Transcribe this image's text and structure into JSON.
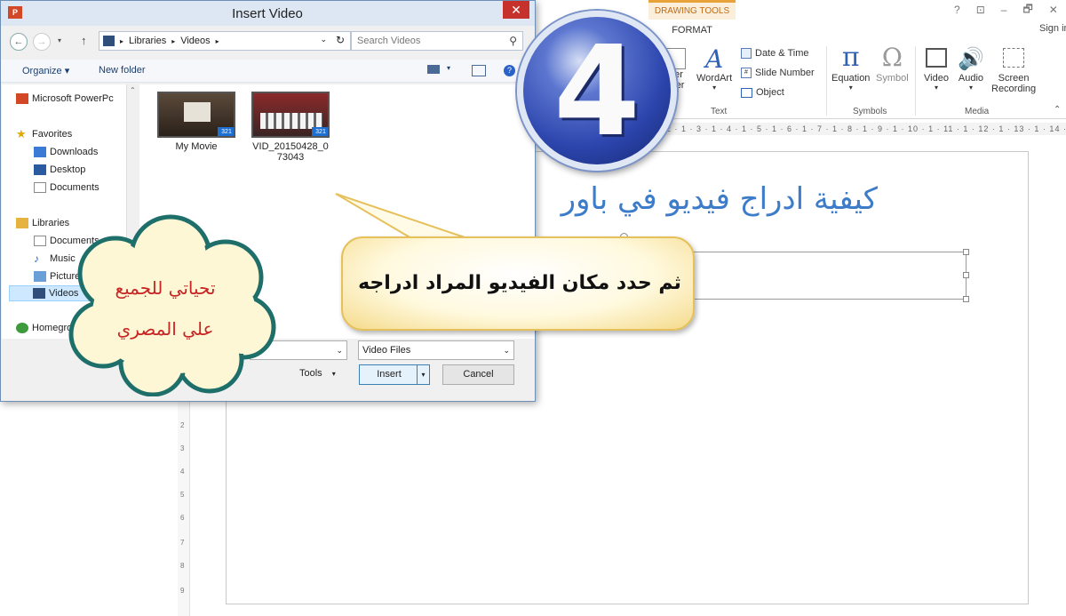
{
  "ppt": {
    "help": "?",
    "minimize": "–",
    "restore": "🗗",
    "close": "✕",
    "sign_in": "Sign in",
    "drawing_tools": "DRAWING TOOLS",
    "format_tab": "FORMAT",
    "ribbon": {
      "header_footer_top": "der",
      "header_footer_bottom": "oter",
      "wordart": "WordArt",
      "date_time": "Date & Time",
      "slide_number": "Slide Number",
      "object": "Object",
      "text_group": "Text",
      "equation": "Equation",
      "symbol": "Symbol",
      "symbols_group": "Symbols",
      "video": "Video",
      "audio": "Audio",
      "screen_recording_1": "Screen",
      "screen_recording_2": "Recording",
      "media_group": "Media"
    },
    "ruler": "2 · 1 · 3 · 1 · 4 · 1 · 5 · 1 · 6 · 1 · 7 · 1 · 8 · 1 · 9 · 1 · 10 · 1 · 11 · 1 · 12 · 1 · 13 · 1 · 14 · 1 · 15 · 1 · 16 ·",
    "vruler": [
      "2",
      "3",
      "4",
      "5",
      "6",
      "7",
      "8",
      "9"
    ],
    "slide_title": "كيفية ادراج فيديو في باور"
  },
  "dialog": {
    "title": "Insert Video",
    "app_icon": "P",
    "address": [
      "Libraries",
      "Videos"
    ],
    "search_placeholder": "Search Videos",
    "organize": "Organize ▾",
    "new_folder": "New folder",
    "nav": {
      "powerpoint": "Microsoft PowerPc",
      "favorites": "Favorites",
      "downloads": "Downloads",
      "desktop": "Desktop",
      "documents": "Documents",
      "libraries": "Libraries",
      "lib_documents": "Documents",
      "music": "Music",
      "pictures": "Pictures",
      "videos": "Videos",
      "homegroup": "Homegroup"
    },
    "files": [
      {
        "name": "My Movie"
      },
      {
        "name": "VID_20150428_073043"
      }
    ],
    "file_type": "Video Files",
    "tools": "Tools",
    "insert": "Insert",
    "cancel": "Cancel"
  },
  "overlay": {
    "step_number": "4",
    "callout": "ثم حدد مكان الفيديو المراد ادراجه",
    "cloud_line1": "تحياتي للجميع",
    "cloud_line2": "علي المصري"
  },
  "colors": {
    "accent_blue": "#2c45ad",
    "callout_fill": "#fff9de",
    "cloud_fill": "#fdf7d6",
    "cloud_border": "#1e6e6a",
    "cloud_text": "#c82424",
    "slide_title": "#3d7cc9"
  }
}
